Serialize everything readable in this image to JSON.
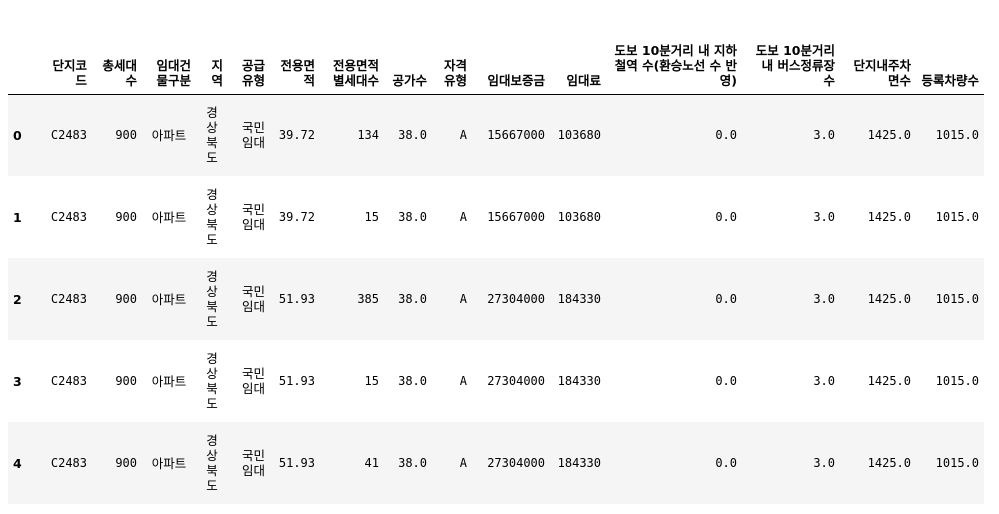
{
  "table": {
    "columns": [
      "",
      "단지코드",
      "총세대수",
      "임대건물구분",
      "지역",
      "공급유형",
      "전용면적",
      "전용면적별세대수",
      "공가수",
      "자격유형",
      "임대보증금",
      "임대료",
      "도보 10분거리 내 지하철역 수(환승노선 수 반영)",
      "도보 10분거리 내 버스정류장 수",
      "단지내주차면수",
      "등록차량수"
    ],
    "rows": [
      {
        "index": "0",
        "cells": [
          "C2483",
          "900",
          "아파트",
          "경상북도",
          "국민임대",
          "39.72",
          "134",
          "38.0",
          "A",
          "15667000",
          "103680",
          "0.0",
          "3.0",
          "1425.0",
          "1015.0"
        ]
      },
      {
        "index": "1",
        "cells": [
          "C2483",
          "900",
          "아파트",
          "경상북도",
          "국민임대",
          "39.72",
          "15",
          "38.0",
          "A",
          "15667000",
          "103680",
          "0.0",
          "3.0",
          "1425.0",
          "1015.0"
        ]
      },
      {
        "index": "2",
        "cells": [
          "C2483",
          "900",
          "아파트",
          "경상북도",
          "국민임대",
          "51.93",
          "385",
          "38.0",
          "A",
          "27304000",
          "184330",
          "0.0",
          "3.0",
          "1425.0",
          "1015.0"
        ]
      },
      {
        "index": "3",
        "cells": [
          "C2483",
          "900",
          "아파트",
          "경상북도",
          "국민임대",
          "51.93",
          "15",
          "38.0",
          "A",
          "27304000",
          "184330",
          "0.0",
          "3.0",
          "1425.0",
          "1015.0"
        ]
      },
      {
        "index": "4",
        "cells": [
          "C2483",
          "900",
          "아파트",
          "경상북도",
          "국민임대",
          "51.93",
          "41",
          "38.0",
          "A",
          "27304000",
          "184330",
          "0.0",
          "3.0",
          "1425.0",
          "1015.0"
        ]
      }
    ]
  }
}
